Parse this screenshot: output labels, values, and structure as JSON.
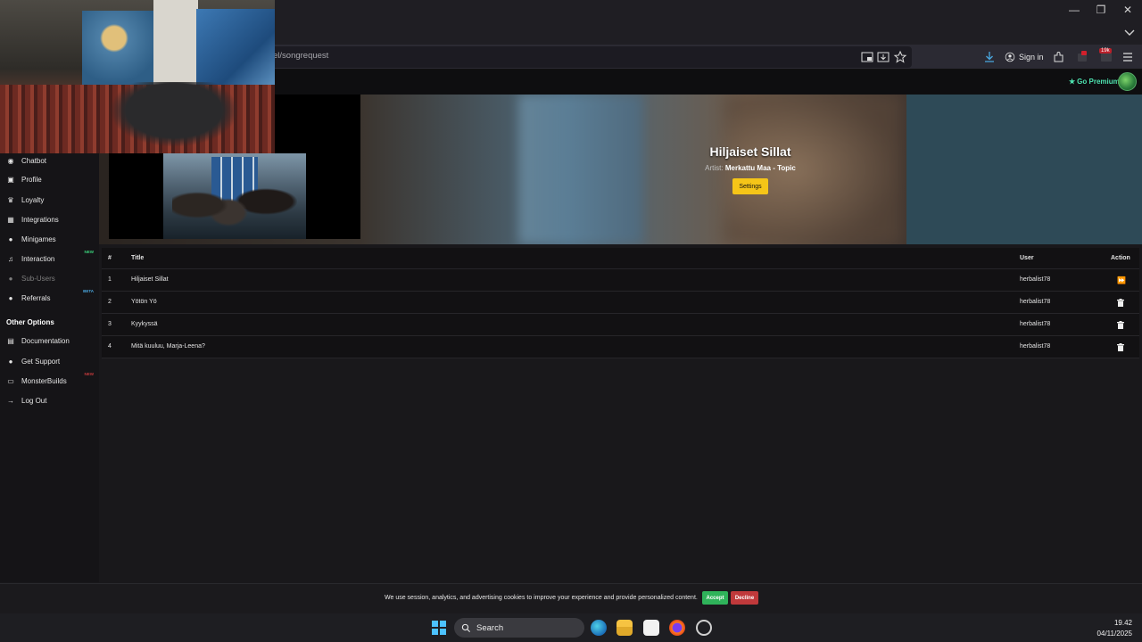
{
  "browser": {
    "url": "el/songrequest",
    "sign_in": "Sign in",
    "extension_badge": "19k"
  },
  "app": {
    "go_premium": "Go Premium"
  },
  "sidebar": {
    "items": [
      {
        "label": "Chatbot",
        "icon": "robot-icon"
      },
      {
        "label": "Profile",
        "icon": "id-card-icon"
      },
      {
        "label": "Loyalty",
        "icon": "trophy-icon"
      },
      {
        "label": "Integrations",
        "icon": "grid-icon"
      },
      {
        "label": "Minigames",
        "icon": "gamepad-icon"
      },
      {
        "label": "Interaction",
        "icon": "music-note-icon",
        "tag": "NEW"
      },
      {
        "label": "Sub-Users",
        "icon": "users-icon"
      },
      {
        "label": "Referrals",
        "icon": "user-plus-icon",
        "tag": "BETA"
      }
    ],
    "other_heading": "Other Options",
    "other_items": [
      {
        "label": "Documentation",
        "icon": "book-icon"
      },
      {
        "label": "Get Support",
        "icon": "support-icon"
      },
      {
        "label": "MonsterBuilds",
        "icon": "monitor-icon",
        "tag": "NEW"
      },
      {
        "label": "Log Out",
        "icon": "logout-icon"
      }
    ]
  },
  "now_playing": {
    "title": "Hiljaiset Sillat",
    "artist_label": "Artist:",
    "artist": "Merkattu Maa - Topic",
    "settings_label": "Settings"
  },
  "queue": {
    "headers": {
      "num": "#",
      "title": "Title",
      "user": "User",
      "action": "Action"
    },
    "rows": [
      {
        "num": "1",
        "title": "Hiljaiset Sillat",
        "user": "herbalist78",
        "action": "skip-icon"
      },
      {
        "num": "2",
        "title": "Yötön Yö",
        "user": "herbalist78",
        "action": "trash-icon"
      },
      {
        "num": "3",
        "title": "Kyykyssä",
        "user": "herbalist78",
        "action": "trash-icon"
      },
      {
        "num": "4",
        "title": "Mitä kuuluu, Marja-Leena?",
        "user": "herbalist78",
        "action": "trash-icon"
      }
    ]
  },
  "cookie": {
    "text": "We use session, analytics, and advertising cookies to improve your experience and provide personalized content.",
    "accept": "Accept",
    "decline": "Decline"
  },
  "taskbar": {
    "search": "Search",
    "time": "19.42",
    "date": "04/11/2025"
  },
  "colors": {
    "accent_yellow": "#f5c518",
    "accept_green": "#2fb35a",
    "decline_red": "#c0393b",
    "premium_green": "#4ee3b0",
    "tag_new": "#3ad07a",
    "tag_beta": "#4aa8e0"
  }
}
